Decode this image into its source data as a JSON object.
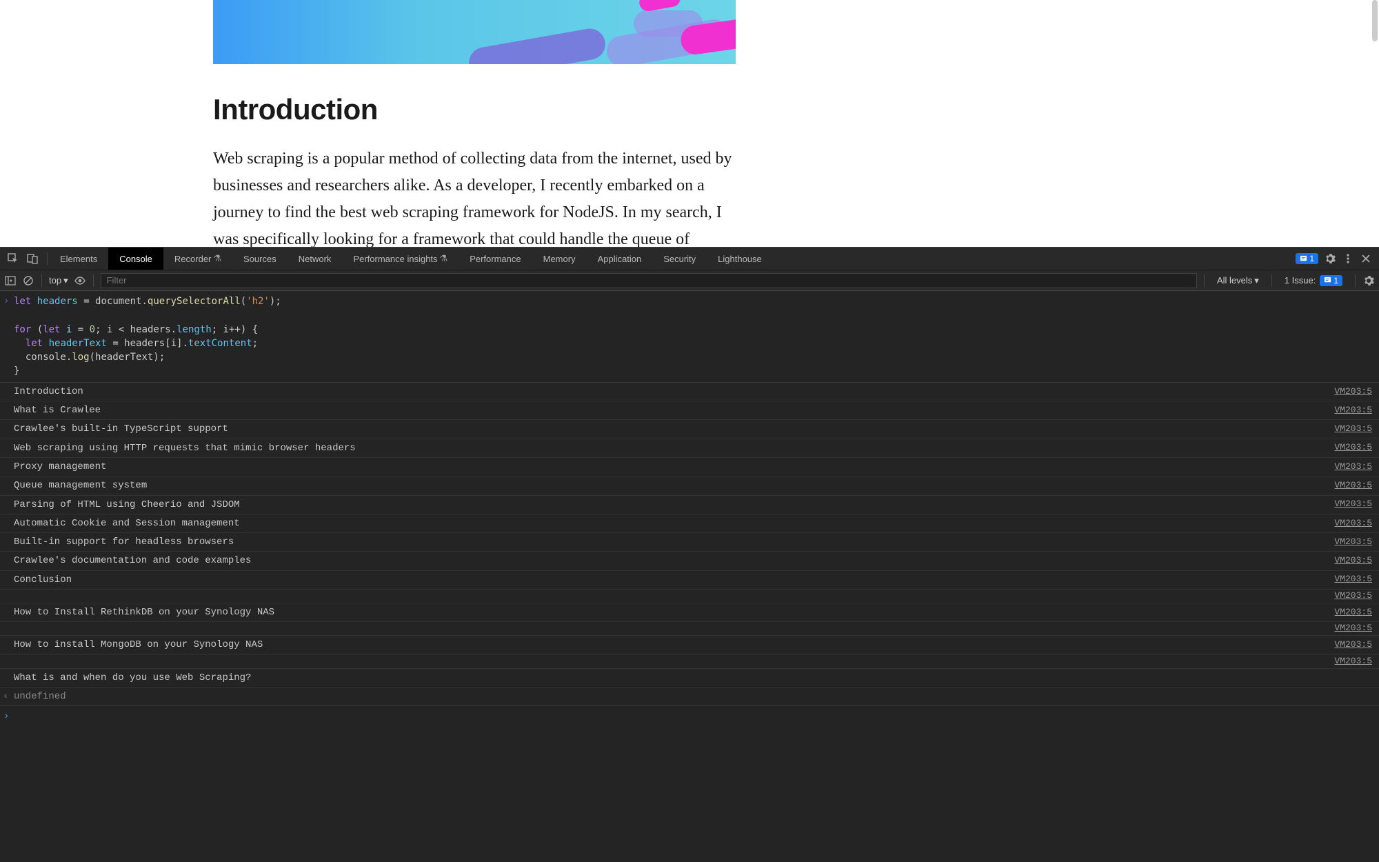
{
  "article": {
    "heading": "Introduction",
    "body": "Web scraping is a popular method of collecting data from the internet, used by businesses and researchers alike. As a developer, I recently embarked on a journey to find the best web scraping framework for NodeJS. In my search, I was specifically looking for a framework that could handle the queue of requests and proxy management without requiring me to implement the code myself."
  },
  "devtools": {
    "tabs": [
      "Elements",
      "Console",
      "Recorder",
      "Sources",
      "Network",
      "Performance insights",
      "Performance",
      "Memory",
      "Application",
      "Security",
      "Lighthouse"
    ],
    "active_tab": "Console",
    "issue_badge": "1",
    "toolbar": {
      "context": "top",
      "filter_placeholder": "Filter",
      "levels": "All levels",
      "issues_label": "1 Issue:",
      "issues_count": "1"
    },
    "code": {
      "line1_a": "let",
      "line1_b": "headers",
      "line1_c": "= document.",
      "line1_d": "querySelectorAll",
      "line1_e": "(",
      "line1_f": "'h2'",
      "line1_g": ");",
      "line2_a": "for",
      "line2_b": "(",
      "line2_c": "let",
      "line2_d": "i",
      "line2_e": "=",
      "line2_f": "0",
      "line2_g": "; i < headers.",
      "line2_h": "length",
      "line2_i": "; i++) {",
      "line3_a": "let",
      "line3_b": "headerText",
      "line3_c": "= headers[i].",
      "line3_d": "textContent",
      "line3_e": ";",
      "line4_a": "console.",
      "line4_b": "log",
      "line4_c": "(headerText);",
      "line5": "}"
    },
    "logs": [
      "Introduction",
      "What is Crawlee",
      "Crawlee's built-in TypeScript support",
      "Web scraping using HTTP requests that mimic browser headers",
      "Proxy management",
      "Queue management system",
      "Parsing of HTML using Cheerio and JSDOM",
      "Automatic Cookie and Session management",
      "Built-in support for headless browsers",
      "Crawlee's documentation and code examples",
      "Conclusion"
    ],
    "logs2": [
      "How to Install RethinkDB on your Synology NAS",
      "How to install MongoDB on your Synology NAS",
      "What is and when do you use Web Scraping?"
    ],
    "source": "VM203:5",
    "undefined": "undefined"
  }
}
